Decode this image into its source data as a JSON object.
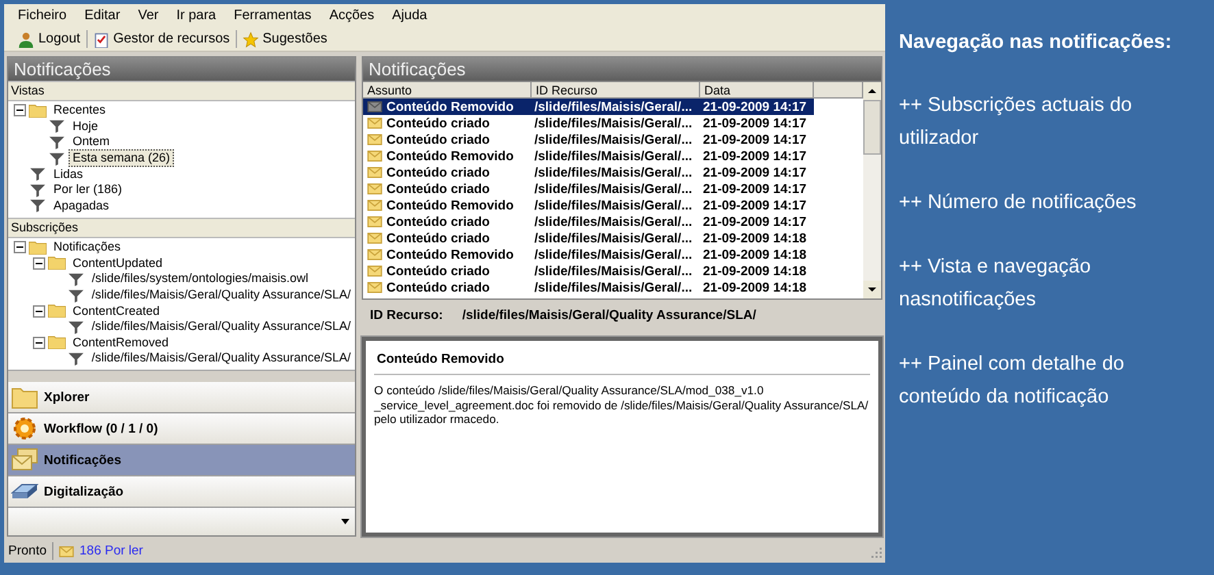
{
  "menu": [
    "Ficheiro",
    "Editar",
    "Ver",
    "Ir para",
    "Ferramentas",
    "Acções",
    "Ajuda"
  ],
  "toolbar": [
    {
      "kind": "logout",
      "label": "Logout"
    },
    {
      "kind": "resources",
      "label": "Gestor de recursos"
    },
    {
      "kind": "suggestions",
      "label": "Sugestões"
    }
  ],
  "left_panel": {
    "title": "Notificações",
    "vistas": {
      "label": "Vistas",
      "tree": [
        {
          "kind": "folder",
          "label": "Recentes",
          "expanded": true,
          "selected": false,
          "children": [
            {
              "kind": "filter",
              "label": "Hoje",
              "selected": false
            },
            {
              "kind": "filter",
              "label": "Ontem",
              "selected": false
            },
            {
              "kind": "filter",
              "label": "Esta semana (26)",
              "selected": true
            }
          ]
        },
        {
          "kind": "filter",
          "label": "Lidas",
          "selected": false
        },
        {
          "kind": "filter",
          "label": "Por ler (186)",
          "selected": false
        },
        {
          "kind": "filter",
          "label": "Apagadas",
          "selected": false
        }
      ]
    },
    "subscricoes": {
      "label": "Subscrições",
      "tree": [
        {
          "kind": "folder",
          "label": "Notificações",
          "expanded": true,
          "selected": false,
          "children": [
            {
              "kind": "folder",
              "label": "ContentUpdated",
              "expanded": true,
              "selected": false,
              "children": [
                {
                  "kind": "filter",
                  "label": "/slide/files/system/ontologies/maisis.owl",
                  "selected": false
                },
                {
                  "kind": "filter",
                  "label": "/slide/files/Maisis/Geral/Quality Assurance/SLA/",
                  "selected": false
                }
              ]
            },
            {
              "kind": "folder",
              "label": "ContentCreated",
              "expanded": true,
              "selected": false,
              "children": [
                {
                  "kind": "filter",
                  "label": "/slide/files/Maisis/Geral/Quality Assurance/SLA/",
                  "selected": false
                }
              ]
            },
            {
              "kind": "folder",
              "label": "ContentRemoved",
              "expanded": true,
              "selected": false,
              "children": [
                {
                  "kind": "filter",
                  "label": "/slide/files/Maisis/Geral/Quality Assurance/SLA/",
                  "selected": false
                }
              ]
            }
          ]
        }
      ]
    },
    "nav": [
      {
        "kind": "explorer",
        "label": "Xplorer",
        "selected": false
      },
      {
        "kind": "workflow",
        "label": "Workflow (0 / 1 / 0)",
        "selected": false
      },
      {
        "kind": "notifications",
        "label": "Notificações",
        "selected": true
      },
      {
        "kind": "scanning",
        "label": "Digitalização",
        "selected": false
      }
    ]
  },
  "right_panel": {
    "title": "Notificações",
    "table": {
      "columns": [
        "Assunto",
        "ID Recurso",
        "Data"
      ],
      "rows": [
        {
          "subject": "Conteúdo Removido",
          "resource": "/slide/files/Maisis/Geral/...",
          "date": "21-09-2009 14:17",
          "read": true,
          "selected": true
        },
        {
          "subject": "Conteúdo criado",
          "resource": "/slide/files/Maisis/Geral/...",
          "date": "21-09-2009 14:17",
          "read": false,
          "selected": false
        },
        {
          "subject": "Conteúdo criado",
          "resource": "/slide/files/Maisis/Geral/...",
          "date": "21-09-2009 14:17",
          "read": false,
          "selected": false
        },
        {
          "subject": "Conteúdo Removido",
          "resource": "/slide/files/Maisis/Geral/...",
          "date": "21-09-2009 14:17",
          "read": false,
          "selected": false
        },
        {
          "subject": "Conteúdo criado",
          "resource": "/slide/files/Maisis/Geral/...",
          "date": "21-09-2009 14:17",
          "read": false,
          "selected": false
        },
        {
          "subject": "Conteúdo criado",
          "resource": "/slide/files/Maisis/Geral/...",
          "date": "21-09-2009 14:17",
          "read": false,
          "selected": false
        },
        {
          "subject": "Conteúdo Removido",
          "resource": "/slide/files/Maisis/Geral/...",
          "date": "21-09-2009 14:17",
          "read": false,
          "selected": false
        },
        {
          "subject": "Conteúdo criado",
          "resource": "/slide/files/Maisis/Geral/...",
          "date": "21-09-2009 14:17",
          "read": false,
          "selected": false
        },
        {
          "subject": "Conteúdo criado",
          "resource": "/slide/files/Maisis/Geral/...",
          "date": "21-09-2009 14:18",
          "read": false,
          "selected": false
        },
        {
          "subject": "Conteúdo Removido",
          "resource": "/slide/files/Maisis/Geral/...",
          "date": "21-09-2009 14:18",
          "read": false,
          "selected": false
        },
        {
          "subject": "Conteúdo criado",
          "resource": "/slide/files/Maisis/Geral/...",
          "date": "21-09-2009 14:18",
          "read": false,
          "selected": false
        },
        {
          "subject": "Conteúdo criado",
          "resource": "/slide/files/Maisis/Geral/...",
          "date": "21-09-2009 14:18",
          "read": false,
          "selected": false
        }
      ]
    },
    "resource_label": "ID Recurso:",
    "resource_value": "/slide/files/Maisis/Geral/Quality Assurance/SLA/",
    "detail": {
      "title": "Conteúdo Removido",
      "body": "O conteúdo /slide/files/Maisis/Geral/Quality Assurance/SLA/mod_038_v1.0 _service_level_agreement.doc foi removido de /slide/files/Maisis/Geral/Quality Assurance/SLA/ pelo utilizador rmacedo."
    }
  },
  "status_bar": {
    "status": "Pronto",
    "unread": "186 Por ler"
  },
  "notes": {
    "title": "Navegação nas notificações:",
    "items": [
      "++ Subscrições actuais do utilizador",
      "++ Número de notificações",
      "++ Vista e navegação nasnotificações",
      "++ Painel com detalhe do conteúdo da notificação"
    ]
  }
}
